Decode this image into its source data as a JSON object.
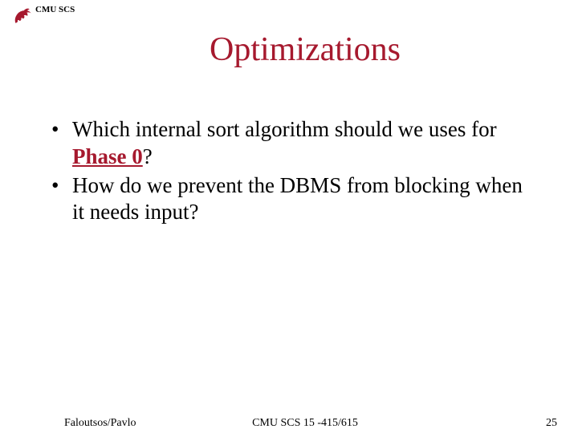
{
  "header": {
    "label": "CMU SCS"
  },
  "title": "Optimizations",
  "bullets": [
    {
      "prefix": "Which internal sort algorithm should we uses for ",
      "highlight": "Phase 0",
      "suffix": "?"
    },
    {
      "prefix": "How do we prevent the DBMS from blocking when it needs input?",
      "highlight": "",
      "suffix": ""
    }
  ],
  "footer": {
    "left": "Faloutsos/Pavlo",
    "center": "CMU SCS 15 -415/615",
    "right": "25"
  },
  "colors": {
    "accent": "#a6192e"
  }
}
